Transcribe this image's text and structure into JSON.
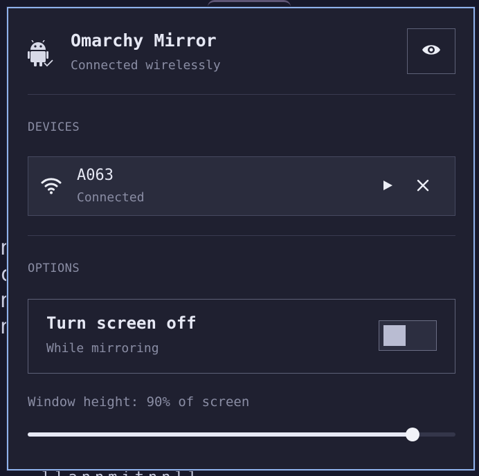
{
  "app": {
    "title": "Omarchy Mirror",
    "subtitle": "Connected wirelessly",
    "icon": "android-icon",
    "header_action_icon": "eye-icon"
  },
  "devices": {
    "section_label": "DEVICES",
    "items": [
      {
        "name": "A063",
        "status": "Connected",
        "connection_icon": "wifi-icon",
        "actions": [
          "play-icon",
          "close-icon"
        ]
      }
    ]
  },
  "options": {
    "section_label": "OPTIONS",
    "screen_off": {
      "title": "Turn screen off",
      "subtitle": "While mirroring",
      "enabled": false
    },
    "window_height": {
      "label": "Window height: 90% of screen",
      "value_percent": 90
    }
  },
  "colors": {
    "background": "#1f2030",
    "border_accent": "#8fb2ec",
    "text_primary": "#e6e8f4",
    "text_secondary": "#8a8da4"
  }
}
